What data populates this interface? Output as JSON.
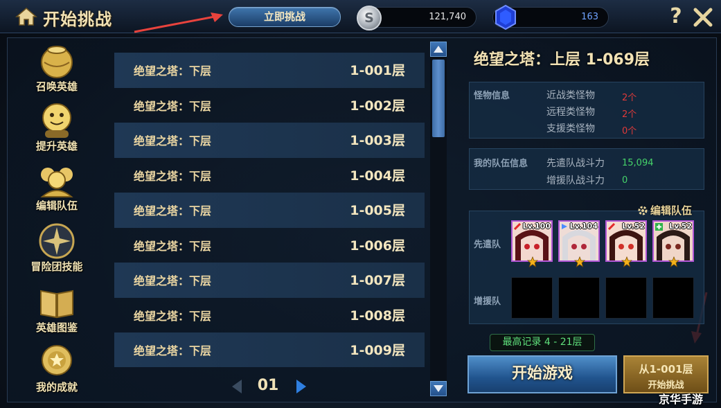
{
  "header": {
    "title": "开始挑战",
    "challenge_button": "立即挑战",
    "silver_value": "121,740",
    "gem_value": "163"
  },
  "nav": [
    {
      "label": "召唤英雄",
      "icon": "summon-urn-icon"
    },
    {
      "label": "提升英雄",
      "icon": "level-up-face-icon"
    },
    {
      "label": "编辑队伍",
      "icon": "team-icon"
    },
    {
      "label": "冒险团技能",
      "icon": "compass-star-icon"
    },
    {
      "label": "英雄图鉴",
      "icon": "book-icon"
    },
    {
      "label": "我的成就",
      "icon": "medal-icon"
    }
  ],
  "floors": [
    {
      "name": "绝望之塔：下层",
      "num": "1-001层"
    },
    {
      "name": "绝望之塔：下层",
      "num": "1-002层"
    },
    {
      "name": "绝望之塔：下层",
      "num": "1-003层"
    },
    {
      "name": "绝望之塔：下层",
      "num": "1-004层"
    },
    {
      "name": "绝望之塔：下层",
      "num": "1-005层"
    },
    {
      "name": "绝望之塔：下层",
      "num": "1-006层"
    },
    {
      "name": "绝望之塔：下层",
      "num": "1-007层"
    },
    {
      "name": "绝望之塔：下层",
      "num": "1-008层"
    },
    {
      "name": "绝望之塔：下层",
      "num": "1-009层"
    }
  ],
  "pager": {
    "page": "01"
  },
  "detail": {
    "title": "绝望之塔：上层 1-069层",
    "monster_section": "怪物信息",
    "monsters": [
      {
        "key": "近战类怪物",
        "value": "2个"
      },
      {
        "key": "远程类怪物",
        "value": "2个"
      },
      {
        "key": "支援类怪物",
        "value": "0个"
      }
    ],
    "team_section": "我的队伍信息",
    "team_stats": [
      {
        "key": "先遣队战斗力",
        "value": "15,094"
      },
      {
        "key": "增援队战斗力",
        "value": "0"
      }
    ],
    "edit_team": "编辑队伍",
    "vanguard_label": "先遣队",
    "support_label": "增援队",
    "heroes": [
      {
        "level": "Lv.100",
        "class_icon": "sword-icon"
      },
      {
        "level": "Lv.104",
        "class_icon": "bow-icon"
      },
      {
        "level": "Lv.52",
        "class_icon": "sword-icon"
      },
      {
        "level": "Lv.52",
        "class_icon": "heal-cross-icon"
      }
    ],
    "record": "最高记录 4 - 21层",
    "start_button": "开始游戏",
    "from_floor_line1": "从1-001层",
    "from_floor_line2": "开始挑战"
  },
  "watermark": "京华手游",
  "colors": {
    "gold_text": "#f2e2b4",
    "monster_count": "#e03a3a",
    "power_value": "#46d46a",
    "record_text": "#5fe07c",
    "hero_frame": "#b257d6",
    "arrow": "#e8433d"
  }
}
